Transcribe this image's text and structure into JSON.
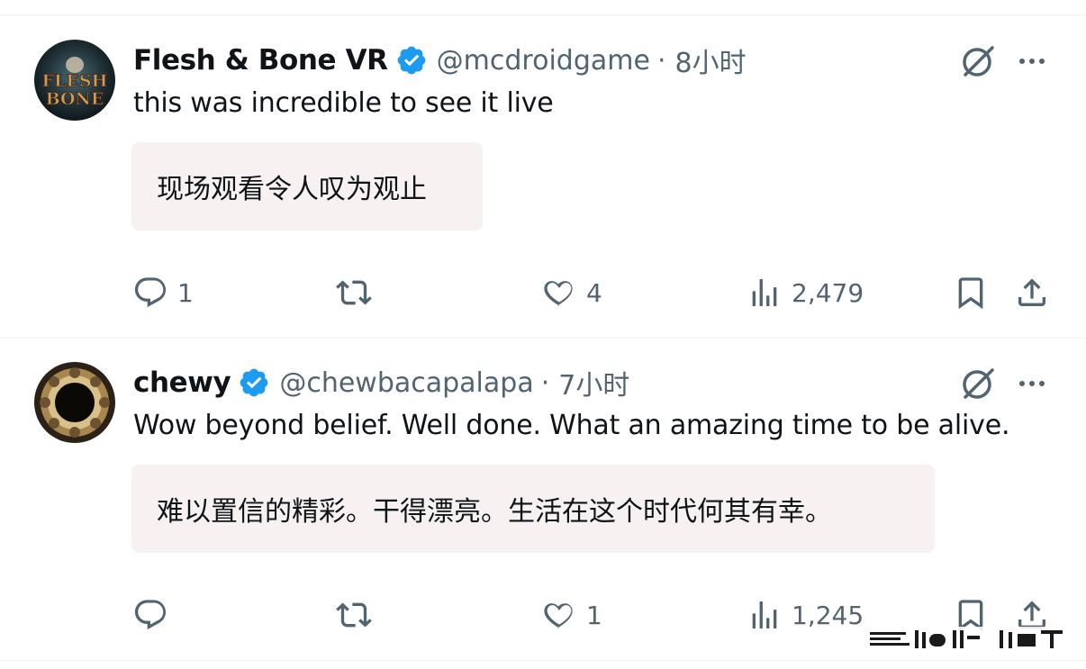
{
  "tweets": [
    {
      "name": "Flesh & Bone VR",
      "handle": "@mcdroidgame",
      "separator": "·",
      "time": "8小时",
      "text": "this was incredible to see it live",
      "translation": "现场观看令人叹为观止",
      "avatar_text": [
        "FLESH",
        "BONE"
      ],
      "actions": {
        "replies": "1",
        "retweets": "",
        "likes": "4",
        "views": "2,479"
      }
    },
    {
      "name": "chewy",
      "handle": "@chewbacapalapa",
      "separator": "·",
      "time": "7小时",
      "text": "Wow beyond belief. Well done. What an amazing time to be alive.",
      "translation": "难以置信的精彩。干得漂亮。生活在这个时代何其有幸。",
      "actions": {
        "replies": "",
        "retweets": "",
        "likes": "1",
        "views": "1,245"
      }
    }
  ],
  "colors": {
    "verified": "#1d9bf0",
    "muted": "#536471",
    "text": "#0f1419",
    "translation_bg": "#f7f2f1"
  },
  "icons": [
    "verified-badge-icon",
    "grok-icon",
    "more-icon",
    "reply-icon",
    "retweet-icon",
    "like-icon",
    "views-icon",
    "bookmark-icon",
    "share-icon"
  ]
}
